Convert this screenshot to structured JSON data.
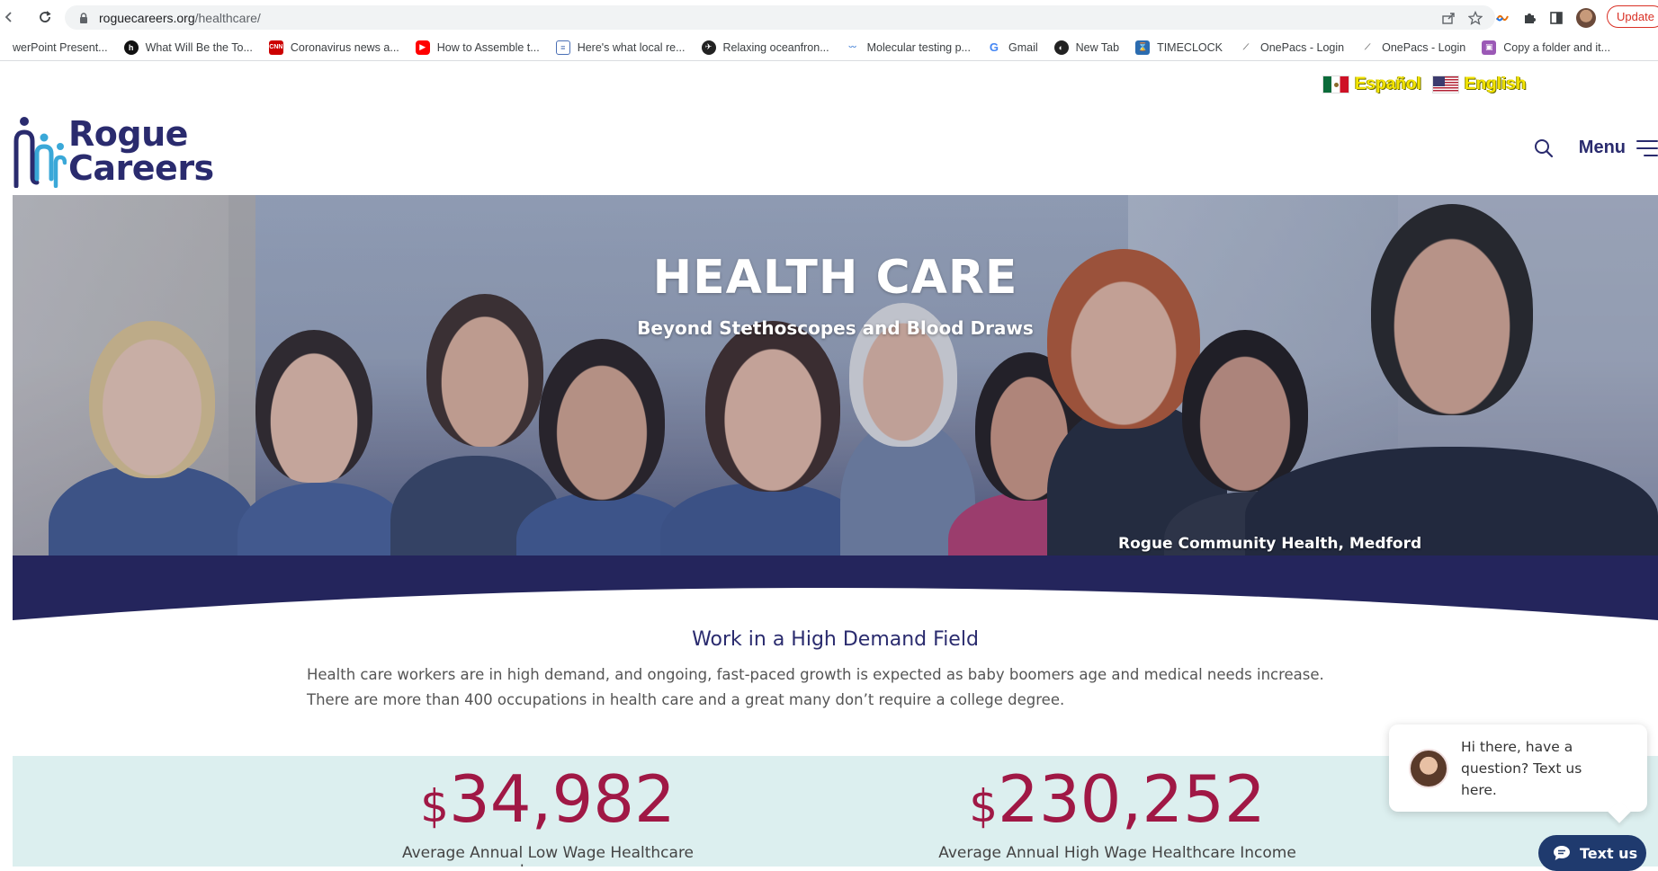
{
  "browser": {
    "url_host": "roguecareers.org",
    "url_path": "/healthcare/",
    "update_label": "Update",
    "bookmarks": [
      {
        "label": "werPoint Present...",
        "icon": "powerpoint-icon"
      },
      {
        "label": "What Will Be the To...",
        "icon": "h-icon"
      },
      {
        "label": "Coronavirus news a...",
        "icon": "cnn-icon"
      },
      {
        "label": "How to Assemble t...",
        "icon": "youtube-icon"
      },
      {
        "label": "Here's what local re...",
        "icon": "news-icon"
      },
      {
        "label": "Relaxing oceanfron...",
        "icon": "compass-icon"
      },
      {
        "label": "Molecular testing p...",
        "icon": "lab-icon"
      },
      {
        "label": "Gmail",
        "icon": "google-icon"
      },
      {
        "label": "New Tab",
        "icon": "globe-icon"
      },
      {
        "label": "TIMECLOCK",
        "icon": "timeclock-icon"
      },
      {
        "label": "OnePacs - Login",
        "icon": "onepacs-icon"
      },
      {
        "label": "OnePacs - Login",
        "icon": "onepacs-icon"
      },
      {
        "label": "Copy a folder and it...",
        "icon": "folder-icon"
      }
    ]
  },
  "lang": {
    "spanish": "Español",
    "english": "English"
  },
  "header": {
    "logo_line1": "Rogue",
    "logo_line2": "Careers",
    "menu_label": "Menu"
  },
  "hero": {
    "title": "HEALTH CARE",
    "subtitle": "Beyond Stethoscopes and Blood Draws",
    "caption": "Rogue Community Health, Medford"
  },
  "section": {
    "title": "Work in a High Demand Field",
    "body": "Health care workers are in high demand, and ongoing, fast-paced growth is expected as baby boomers age and medical needs increase. There are more than 400 occupations in health care and a great many don’t require a college degree."
  },
  "stats": {
    "low": {
      "currency": "$",
      "value": "34,982",
      "label": "Average Annual Low Wage Healthcare Income"
    },
    "high": {
      "currency": "$",
      "value": "230,252",
      "label": "Average Annual High Wage Healthcare Income"
    }
  },
  "chat": {
    "message": "Hi there, have a question? Text us here.",
    "button_label": "Text us"
  },
  "colors": {
    "brand_navy": "#2a2b6e",
    "stat_red": "#a01845",
    "stats_bg": "#dcefef",
    "lang_yellow": "#f4e400"
  }
}
